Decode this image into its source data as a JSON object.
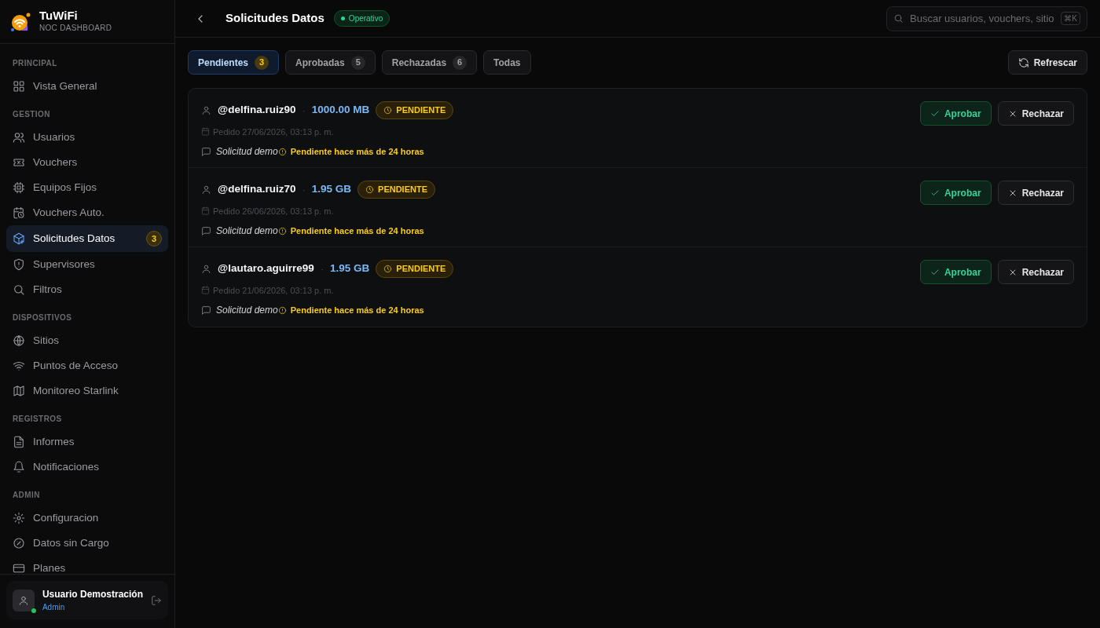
{
  "brand": {
    "name": "TuWiFi",
    "subtitle": "NOC DASHBOARD"
  },
  "sidebar": {
    "sections": [
      {
        "title": "PRINCIPAL",
        "items": [
          {
            "label": "Vista General",
            "selected": false
          }
        ]
      },
      {
        "title": "GESTION",
        "items": [
          {
            "label": "Usuarios",
            "selected": false
          },
          {
            "label": "Vouchers",
            "selected": false
          },
          {
            "label": "Equipos Fijos",
            "selected": false
          },
          {
            "label": "Vouchers Auto.",
            "selected": false
          },
          {
            "label": "Solicitudes Datos",
            "selected": true,
            "badge": "3"
          },
          {
            "label": "Supervisores",
            "selected": false
          },
          {
            "label": "Filtros",
            "selected": false
          }
        ]
      },
      {
        "title": "DISPOSITIVOS",
        "items": [
          {
            "label": "Sitios",
            "selected": false
          },
          {
            "label": "Puntos de Acceso",
            "selected": false
          },
          {
            "label": "Monitoreo Starlink",
            "selected": false
          }
        ]
      },
      {
        "title": "REGISTROS",
        "items": [
          {
            "label": "Informes",
            "selected": false
          },
          {
            "label": "Notificaciones",
            "selected": false
          }
        ]
      },
      {
        "title": "ADMIN",
        "items": [
          {
            "label": "Configuracion",
            "selected": false
          },
          {
            "label": "Datos sin Cargo",
            "selected": false
          },
          {
            "label": "Planes",
            "selected": false
          }
        ]
      }
    ],
    "user": {
      "name": "Usuario Demostración",
      "role": "Admin",
      "online": true
    }
  },
  "header": {
    "title": "Solicitudes Datos",
    "status": "Operativo",
    "search": {
      "placeholder": "Buscar usuarios, vouchers, sitio",
      "shortcut": "⌘K"
    }
  },
  "tabs": [
    {
      "label": "Pendientes",
      "count": "3",
      "selected": true
    },
    {
      "label": "Aprobadas",
      "count": "5",
      "selected": false
    },
    {
      "label": "Rechazadas",
      "count": "6",
      "selected": false
    },
    {
      "label": "Todas",
      "selected": false
    }
  ],
  "refresh_button": "Refrescar",
  "requests": [
    {
      "user": "@delfina.ruiz90",
      "separator": "·",
      "amount": "1000.00 MB",
      "status": "PENDIENTE",
      "date": "Pedido 27/06/2026, 03:13 p. m.",
      "note": "Solicitud demo",
      "warning": "Pendiente hace más de 24 horas",
      "approve": "Aprobar",
      "reject": "Rechazar"
    },
    {
      "user": "@delfina.ruiz70",
      "separator": "·",
      "amount": "1.95 GB",
      "status": "PENDIENTE",
      "date": "Pedido 26/06/2026, 03:13 p. m.",
      "note": "Solicitud demo",
      "warning": "Pendiente hace más de 24 horas",
      "approve": "Aprobar",
      "reject": "Rechazar"
    },
    {
      "user": "@lautaro.aguirre99",
      "separator": "·",
      "amount": "1.95 GB",
      "status": "PENDIENTE",
      "date": "Pedido 21/06/2026, 03:13 p. m.",
      "note": "Solicitud demo",
      "warning": "Pendiente hace más de 24 horas",
      "approve": "Aprobar",
      "reject": "Rechazar"
    }
  ]
}
